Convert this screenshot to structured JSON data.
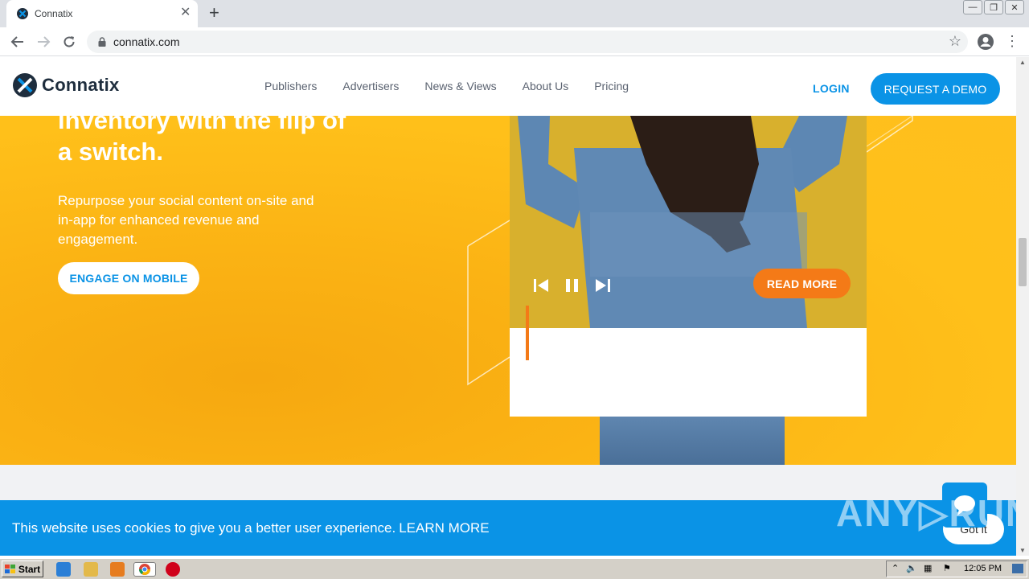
{
  "browser": {
    "tab_title": "Connatix",
    "new_tab": "+",
    "tab_close": "✕",
    "url": "connatix.com",
    "window_controls": [
      "—",
      "❐",
      "✕"
    ]
  },
  "site": {
    "logo_text": "Connatix",
    "nav": [
      "Publishers",
      "Advertisers",
      "News & Views",
      "About Us",
      "Pricing"
    ],
    "login": "LOGIN",
    "demo": "REQUEST A DEMO"
  },
  "hero": {
    "title": "inventory with the flip of a switch.",
    "subtitle": "Repurpose your social content on-site and in-app for enhanced revenue and engagement.",
    "engage_button": "ENGAGE ON MOBILE",
    "read_more": "READ MORE"
  },
  "cookie": {
    "text": "This website uses cookies to give you a better user experience.",
    "learn_more": "LEARN MORE",
    "got_it": "Got it"
  },
  "watermark": "ANY▷RUN",
  "taskbar": {
    "start": "Start",
    "clock": "12:05 PM"
  },
  "colors": {
    "brand_blue": "#0a93e6",
    "hero_yellow": "#ffbf1d",
    "accent_orange": "#f47a17"
  }
}
